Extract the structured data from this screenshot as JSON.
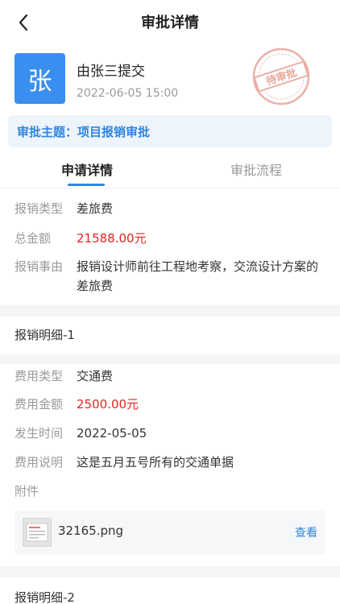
{
  "nav": {
    "title": "审批详情"
  },
  "submitter": {
    "avatar_text": "张",
    "name": "由张三提交",
    "time": "2022-06-05 15:00",
    "stamp_text": "待审批"
  },
  "subject": {
    "text": "审批主题：项目报销审批"
  },
  "tabs": [
    {
      "label": "申请详情",
      "active": true
    },
    {
      "label": "审批流程",
      "active": false
    }
  ],
  "summary": {
    "rows": [
      {
        "label": "报销类型",
        "value": "差旅费"
      },
      {
        "label": "总金额",
        "value": "21588.00元"
      },
      {
        "label": "报销事由",
        "value": "报销设计师前往工程地考察，交流设计方案的差旅费"
      }
    ]
  },
  "details": [
    {
      "title": "报销明细-1",
      "rows": [
        {
          "label": "费用类型",
          "value": "交通费"
        },
        {
          "label": "费用金额",
          "value": "2500.00元"
        },
        {
          "label": "发生时间",
          "value": "2022-05-05"
        },
        {
          "label": "费用说明",
          "value": "这是五月五号所有的交通单据"
        }
      ],
      "attachment_label": "附件",
      "attachment": {
        "file_name": "32165.png",
        "action_label": "查看"
      }
    },
    {
      "title": "报销明细-2"
    }
  ],
  "colors": {
    "accent": "#2e86e0",
    "amount": "#e0251f",
    "stamp": "#e8a69a"
  }
}
